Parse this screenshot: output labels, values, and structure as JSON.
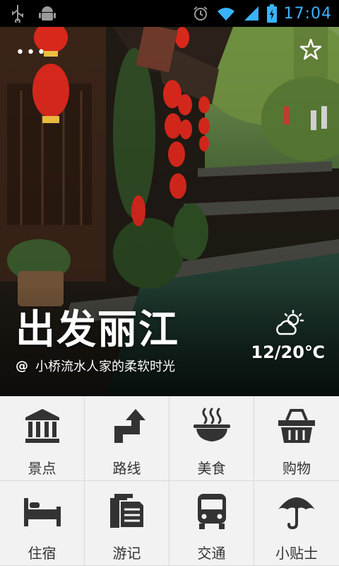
{
  "status_bar": {
    "time": "17:04",
    "icons": [
      "usb-icon",
      "android-debug-icon",
      "alarm-icon",
      "wifi-icon",
      "signal-icon",
      "battery-charging-icon"
    ]
  },
  "hero": {
    "title": "出发丽江",
    "subtitle_prefix": "@",
    "subtitle": "小桥流水人家的柔软时光",
    "more_icon": "more-dots-icon",
    "favorite_icon": "star-outline-icon",
    "weather": {
      "icon": "partly-cloudy-icon",
      "temperature": "12/20℃"
    }
  },
  "menu": [
    {
      "key": "attractions",
      "label": "景点",
      "icon": "landmark-icon"
    },
    {
      "key": "routes",
      "label": "路线",
      "icon": "route-turn-icon"
    },
    {
      "key": "food",
      "label": "美食",
      "icon": "food-bowl-icon"
    },
    {
      "key": "shopping",
      "label": "购物",
      "icon": "shopping-basket-icon"
    },
    {
      "key": "lodging",
      "label": "住宿",
      "icon": "bed-icon"
    },
    {
      "key": "travelogue",
      "label": "游记",
      "icon": "notes-icon"
    },
    {
      "key": "transport",
      "label": "交通",
      "icon": "bus-icon"
    },
    {
      "key": "tips",
      "label": "小贴士",
      "icon": "umbrella-icon"
    }
  ],
  "colors": {
    "time": "#3ab3ff",
    "grid_bg": "#f2f2f2",
    "grid_line": "#d8d8d8",
    "icon": "#333333"
  }
}
